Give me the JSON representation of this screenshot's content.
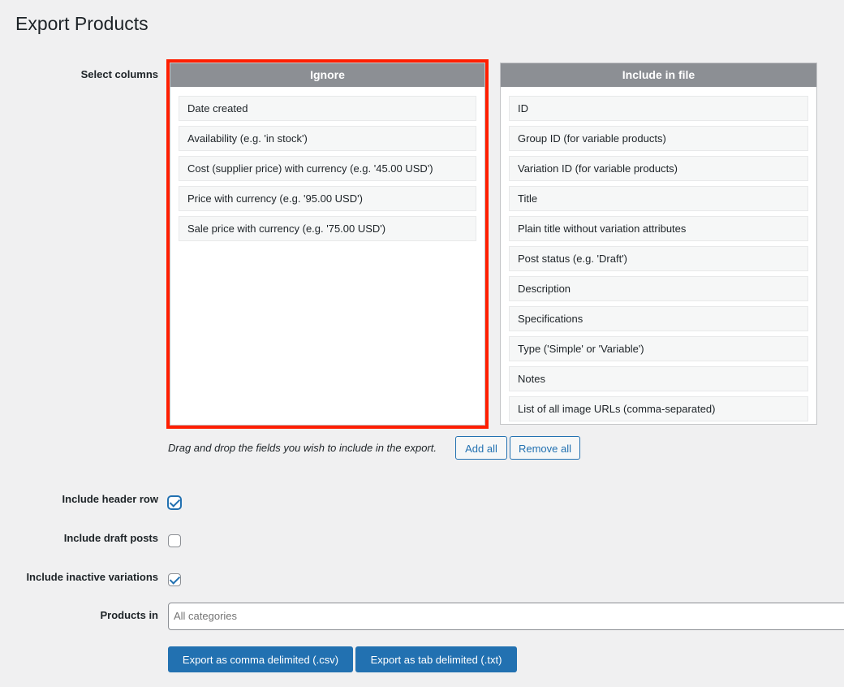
{
  "page": {
    "title": "Export Products"
  },
  "labels": {
    "select_columns": "Select columns",
    "include_header_row": "Include header row",
    "include_draft_posts": "Include draft posts",
    "include_inactive_variations": "Include inactive variations",
    "products_in": "Products in"
  },
  "ignore_panel": {
    "title": "Ignore",
    "items": [
      "Date created",
      "Availability (e.g. 'in stock')",
      "Cost (supplier price) with currency (e.g. '45.00 USD')",
      "Price with currency (e.g. '95.00 USD')",
      "Sale price with currency (e.g. '75.00 USD')"
    ]
  },
  "include_panel": {
    "title": "Include in file",
    "items": [
      "ID",
      "Group ID (for variable products)",
      "Variation ID (for variable products)",
      "Title",
      "Plain title without variation attributes",
      "Post status (e.g. 'Draft')",
      "Description",
      "Specifications",
      "Type ('Simple' or 'Variable')",
      "Notes",
      "List of all image URLs (comma-separated)"
    ]
  },
  "helper_text": "Drag and drop the fields you wish to include in the export.",
  "buttons": {
    "add_all": "Add all",
    "remove_all": "Remove all",
    "export_csv": "Export as comma delimited (.csv)",
    "export_txt": "Export as tab delimited (.txt)"
  },
  "checkboxes": {
    "include_header_row": true,
    "include_draft_posts": false,
    "include_inactive_variations": true
  },
  "products_in": {
    "placeholder": "All categories"
  },
  "colors": {
    "accent": "#2271b1",
    "highlight_border": "#ff1e00",
    "panel_header": "#8c8f94"
  }
}
